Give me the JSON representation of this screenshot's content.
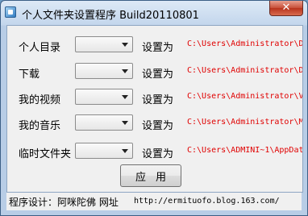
{
  "window": {
    "title": "个人文件夹设置程序 Build20110801",
    "close_glyph": "✕",
    "app_icon": "app-folder-icon"
  },
  "rows": [
    {
      "label": "个人目录",
      "set_label": "设置为",
      "path": "C:\\Users\\Administrator\\D"
    },
    {
      "label": "下载",
      "set_label": "设置为",
      "path": "C:\\Users\\Administrator\\D"
    },
    {
      "label": "我的视频",
      "set_label": "设置为",
      "path": "C:\\Users\\Administrator\\V"
    },
    {
      "label": "我的音乐",
      "set_label": "设置为",
      "path": "C:\\Users\\Administrator\\M"
    },
    {
      "label": "临时文件夹",
      "set_label": "设置为",
      "path": "C:\\Users\\ADMINI~1\\AppDat"
    }
  ],
  "apply_label": "应用",
  "status": {
    "text": "程序设计：阿咪陀佛  网址",
    "url": "http://ermituofo.blog.163.com/"
  },
  "colors": {
    "path_text": "#e00000",
    "frame": "#b8cde6"
  }
}
